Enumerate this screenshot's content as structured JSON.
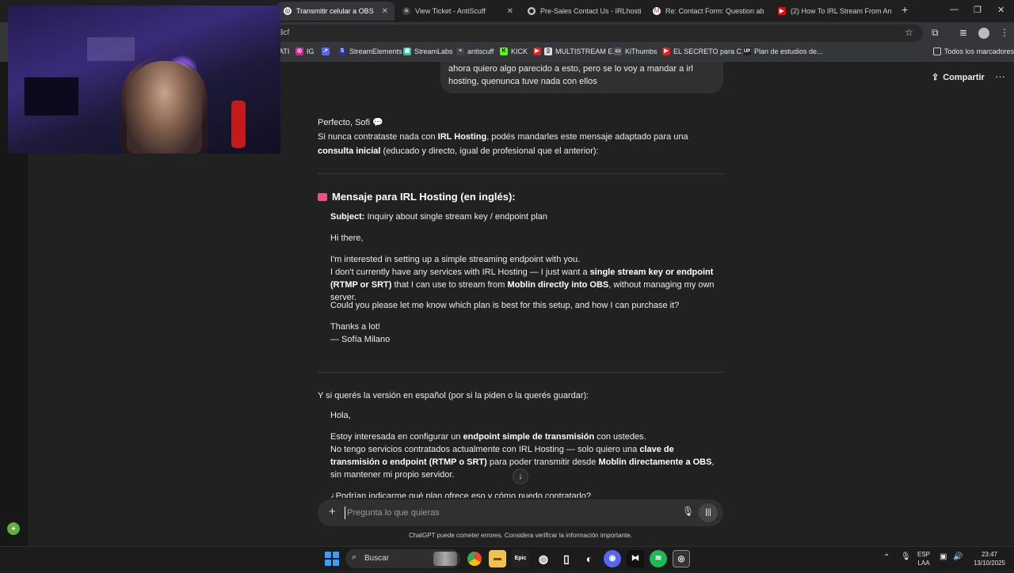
{
  "browser": {
    "tabs": [
      {
        "title": "Transmitir celular a OBS",
        "active": true
      },
      {
        "title": "View Ticket - AntiScuff",
        "active": false
      },
      {
        "title": "Pre-Sales Contact Us - IRLhosti",
        "active": false
      },
      {
        "title": "Re: Contact Form: Question ab",
        "active": false
      },
      {
        "title": "(2) How To IRL Stream From An",
        "active": false
      }
    ],
    "new_tab": "+",
    "window_controls": [
      "—",
      "❐",
      "✕"
    ],
    "address": "3cf",
    "bookmarks": [
      {
        "label": "ATI",
        "color": "#35363a"
      },
      {
        "label": "IG",
        "color": "#d6249f"
      },
      {
        "label": "",
        "color": "#5865f2"
      },
      {
        "label": "StreamElements",
        "color": "#2c2fa8"
      },
      {
        "label": "StreamLabs",
        "color": "#31c3a2"
      },
      {
        "label": "antiscuff",
        "color": "#35363a"
      },
      {
        "label": "KICK",
        "color": "#53fc18"
      },
      {
        "label": "MULTISTREAM E...",
        "color": "#e02020"
      },
      {
        "label": "KiThumbs",
        "color": "#555555"
      },
      {
        "label": "EL SECRETO para C...",
        "color": "#e02020"
      },
      {
        "label": "Plan de estudios de...",
        "color": "#222222"
      }
    ],
    "all_bookmarks": "Todos los marcadores"
  },
  "chat": {
    "share_label": "Compartir",
    "user_message": "ahora quiero algo parecido a esto, pero se lo voy a mandar a irl hosting, quenunca tuve nada con ellos",
    "greeting": "Perfecto, Sofi 💬",
    "intro_parts": {
      "p1": "Si nunca contrataste nada con ",
      "b1": "IRL Hosting",
      "p2": ", podés mandarles este mensaje adaptado para una ",
      "b2": "consulta inicial",
      "p3": " (educado y directo, igual de profesional que el anterior):"
    },
    "english_heading": "Mensaje para IRL Hosting (en inglés):",
    "english": {
      "subject_label": "Subject:",
      "subject": " Inquiry about single stream key / endpoint plan",
      "hi": "Hi there,",
      "l1": "I'm interested in setting up a simple streaming endpoint with you.",
      "l2a": "I don't currently have any services with IRL Hosting — I just want a ",
      "l2b": "single stream key or endpoint (RTMP or SRT)",
      "l2c": " that I can use to stream from ",
      "l2d": "Moblin directly into OBS",
      "l2e": ", without managing my own server.",
      "l3": "Could you please let me know which plan is best for this setup, and how I can purchase it?",
      "thanks": "Thanks a lot!",
      "sign": "— Sofía Milano"
    },
    "spanish_intro": "Y si querés la versión en español (por si la piden o la querés guardar):",
    "spanish": {
      "hola": "Hola,",
      "l1a": "Estoy interesada en configurar un ",
      "l1b": "endpoint simple de transmisión",
      "l1c": " con ustedes.",
      "l2a": "No tengo servicios contratados actualmente con IRL Hosting — solo quiero una ",
      "l2b": "clave de transmisión o endpoint (RTMP o SRT)",
      "l2c": " para poder transmitir desde ",
      "l2d": "Moblin directamente a OBS",
      "l2e": ", sin mantener mi propio servidor.",
      "l3": "¿Podrían indicarme qué plan ofrece eso y cómo puedo contratarlo?"
    },
    "composer_placeholder": "Pregunta lo que quieras",
    "disclaimer": "ChatGPT puede cometer errores. Considera verificar la información importante."
  },
  "taskbar": {
    "search_label": "Buscar",
    "apps": [
      "Epic",
      "GitHub",
      "Files",
      "Edge",
      "Discord",
      "CapCut",
      "Spotify",
      "OBS"
    ],
    "lang_top": "ESP",
    "lang_bottom": "LAA",
    "time": "23:47",
    "date": "13/10/2025"
  }
}
